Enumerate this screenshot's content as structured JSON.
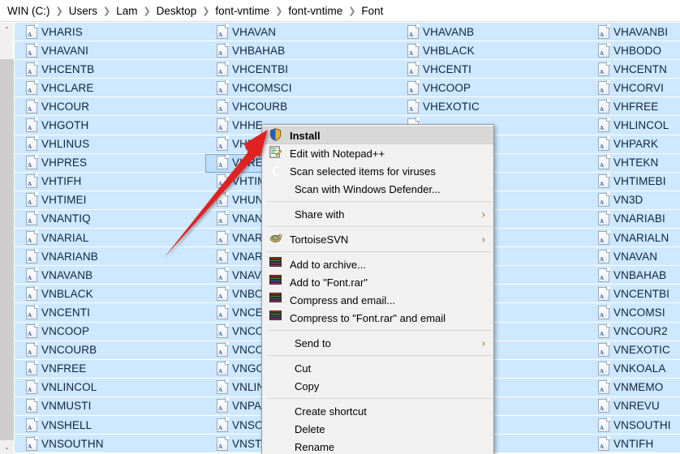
{
  "breadcrumb": {
    "separator": "❯",
    "items": [
      {
        "label": "WIN (C:)"
      },
      {
        "label": "Users"
      },
      {
        "label": "Lam"
      },
      {
        "label": "Desktop"
      },
      {
        "label": "font-vntime"
      },
      {
        "label": "font-vntime"
      },
      {
        "label": "Font"
      }
    ]
  },
  "scrollbar": {
    "up_arrow": "⌃",
    "down_arrow": "⌄"
  },
  "file_list": {
    "icon_name": "document-icon",
    "icon_glyph": "A",
    "columns": [
      {
        "items": [
          "VHARIS",
          "VHAVANI",
          "VHCENTB",
          "VHCLARE",
          "VHCOUR",
          "VHGOTH",
          "VHLINUS",
          "VHPRES",
          "VHTIFH",
          "VHTIMEI",
          "VNANTIQ",
          "VNARIAL",
          "VNARIANB",
          "VNAVANB",
          "VNBLACK",
          "VNCENTI",
          "VNCOOP",
          "VNCOURB",
          "VNFREE",
          "VNLINCOL",
          "VNMUSTI",
          "VNSHELL",
          "VNSOUTHN"
        ]
      },
      {
        "items": [
          "VHAVAN",
          "VHBAHAB",
          "VHCENTBI",
          "VHCOMSCI",
          "VHCOURB",
          "VHHE",
          "VHME",
          "VHREV",
          "VHTIM",
          "VHUN",
          "VNAN",
          "VNAR",
          "VNAR",
          "VNAV",
          "VNBO",
          "VNCE",
          "VNCO",
          "VNCO",
          "VNGO",
          "VNLIN",
          "VNPA",
          "VNSO",
          "VNSTA"
        ],
        "selected_index": 7
      },
      {
        "items": [
          "VHAVANB",
          "VHBLACK",
          "VHCENTI",
          "VHCOOP",
          "VHEXOTIC",
          "",
          "",
          "",
          "",
          "",
          "",
          "",
          "",
          "",
          "",
          "",
          "",
          "",
          "",
          "",
          "",
          "",
          ""
        ]
      },
      {
        "items": [
          "VHAVANBI",
          "VHBODO",
          "VHCENTN",
          "VHCORVI",
          "VHFREE",
          "VHLINCOL",
          "VHPARK",
          "VHTEKN",
          "VHTIMEBI",
          "VN3D",
          "VNARIABI",
          "VNARIALN",
          "VNAVAN",
          "VNBAHAB",
          "VNCENTBI",
          "VNCOMSI",
          "VNCOUR2",
          "VNEXOTIC",
          "VNKOALA",
          "VNMEMO",
          "VNREVU",
          "VNSOUTHI",
          "VNTIFH"
        ]
      }
    ]
  },
  "context_menu": {
    "submenu_arrow": "›",
    "items": [
      {
        "type": "item",
        "label": "Install",
        "icon": "shield-icon",
        "bold": true,
        "highlight": true
      },
      {
        "type": "item",
        "label": "Edit with Notepad++",
        "icon": "notepad-plus-plus-icon"
      },
      {
        "type": "item",
        "label": "Scan selected items for viruses",
        "icon": "antivirus-icon"
      },
      {
        "type": "item",
        "label": "Scan with Windows Defender...",
        "icon": "none"
      },
      {
        "type": "separator"
      },
      {
        "type": "item",
        "label": "Share with",
        "icon": "none",
        "submenu": true
      },
      {
        "type": "separator"
      },
      {
        "type": "item",
        "label": "TortoiseSVN",
        "icon": "tortoisesvn-icon",
        "submenu": true
      },
      {
        "type": "separator"
      },
      {
        "type": "item",
        "label": "Add to archive...",
        "icon": "winrar-icon"
      },
      {
        "type": "item",
        "label": "Add to \"Font.rar\"",
        "icon": "winrar-icon"
      },
      {
        "type": "item",
        "label": "Compress and email...",
        "icon": "winrar-icon"
      },
      {
        "type": "item",
        "label": "Compress to \"Font.rar\" and email",
        "icon": "winrar-icon"
      },
      {
        "type": "separator"
      },
      {
        "type": "item",
        "label": "Send to",
        "icon": "none",
        "submenu": true
      },
      {
        "type": "separator"
      },
      {
        "type": "item",
        "label": "Cut",
        "icon": "none"
      },
      {
        "type": "item",
        "label": "Copy",
        "icon": "none"
      },
      {
        "type": "separator"
      },
      {
        "type": "item",
        "label": "Create shortcut",
        "icon": "none"
      },
      {
        "type": "item",
        "label": "Delete",
        "icon": "none"
      },
      {
        "type": "item",
        "label": "Rename",
        "icon": "none"
      },
      {
        "type": "separator"
      }
    ]
  },
  "annotation": {
    "arrow_color": "#e02020",
    "name": "red-pointer-arrow"
  }
}
